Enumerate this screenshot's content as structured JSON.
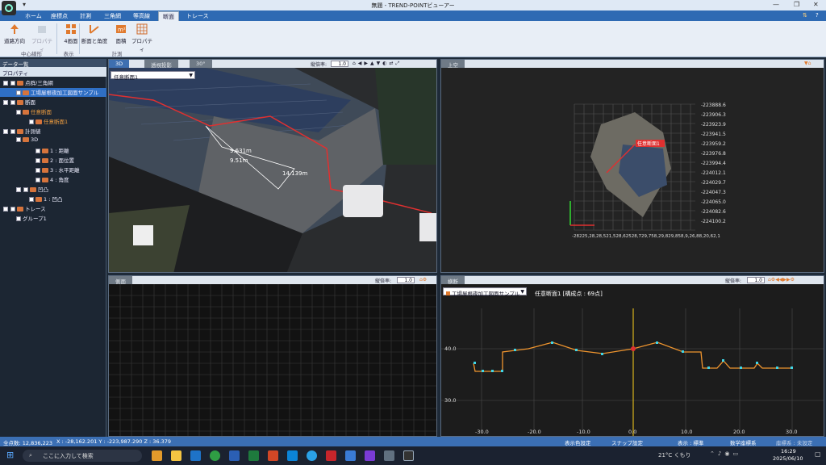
{
  "window": {
    "title": "無題 - TREND-POINTビューアー"
  },
  "tabs": [
    "ホーム",
    "座標点",
    "計測",
    "三角網",
    "等高線",
    "断面",
    "トレース"
  ],
  "active_tab": "断面",
  "ribbon": {
    "buttons": [
      "道路方向",
      "プロパティ",
      "4画面",
      "断面と角度",
      "面積",
      "プロパティ"
    ],
    "groups": [
      "中心線形",
      "表示",
      "計測"
    ]
  },
  "left_panel": {
    "title": "データ一覧",
    "property_label": "プロパティ",
    "tree": [
      "点群/三角網",
      "工場屋根夜加工図面サンプル",
      "断面",
      "任意断面",
      "任意断面1",
      "計測値",
      "3D",
      "1 : 距離",
      "2 : 面位置",
      "3 : 水平距離",
      "4 : 角度",
      "凹凸",
      "1 : 凹凸",
      "トレース",
      "グループ1"
    ]
  },
  "viewport_3d": {
    "tabs": [
      "3D",
      "透視投影",
      "30°"
    ],
    "scale_label": "縦倍率:",
    "scale_value": "1.0",
    "section_select": "任意断面1",
    "labels": [
      "9.631m",
      "9.51m",
      "14.139m"
    ]
  },
  "viewport_top": {
    "tab": "上空",
    "section_label": "任意断面1",
    "y_ticks": [
      "-223888.6",
      "-223906.3",
      "-223923.9",
      "-223941.5",
      "-223959.2",
      "-223976.8",
      "-223994.4",
      "-224012.1",
      "-224029.7",
      "-224047.3",
      "-224065.0",
      "-224082.6",
      "-224100.2"
    ],
    "x_ticks_text": "-28225,28,28,521,528,62528,729,758,29,829,858,9,26,88,20,62,1"
  },
  "viewport_side": {
    "tab": "側面",
    "scale_label": "縦倍率:",
    "scale_value": "1.0"
  },
  "viewport_cross": {
    "tab": "横断",
    "scale_label": "縦倍率:",
    "scale_value": "1.0",
    "dataset_select": "工場屋根夜加工図面サンプル",
    "info": "任意断面1 [構成点 : 69点]",
    "y_ticks": [
      "40.0",
      "30.0"
    ],
    "x_ticks": [
      "-30.0",
      "-20.0",
      "-10.0",
      "0.0",
      "10.0",
      "20.0",
      "30.0"
    ]
  },
  "status": {
    "points": "全点数: 12,836,223",
    "coords": "X : -28,162.201  Y : -223,987.290  Z : 36.379",
    "color_setting": "表示色設定",
    "snap_setting": "スナップ設定",
    "display": "表示 : 標準",
    "coord_system": "数学座標系",
    "coord_sys_setting": "座標系 : 未設定"
  },
  "taskbar": {
    "search_placeholder": "ここに入力して検索",
    "weather": "21°C  くもり",
    "time": "16:29",
    "date": "2025/06/10"
  },
  "colors": {
    "accent": "#2e6ab3",
    "section_line": "#e03030",
    "profile_line": "#f0952e"
  }
}
